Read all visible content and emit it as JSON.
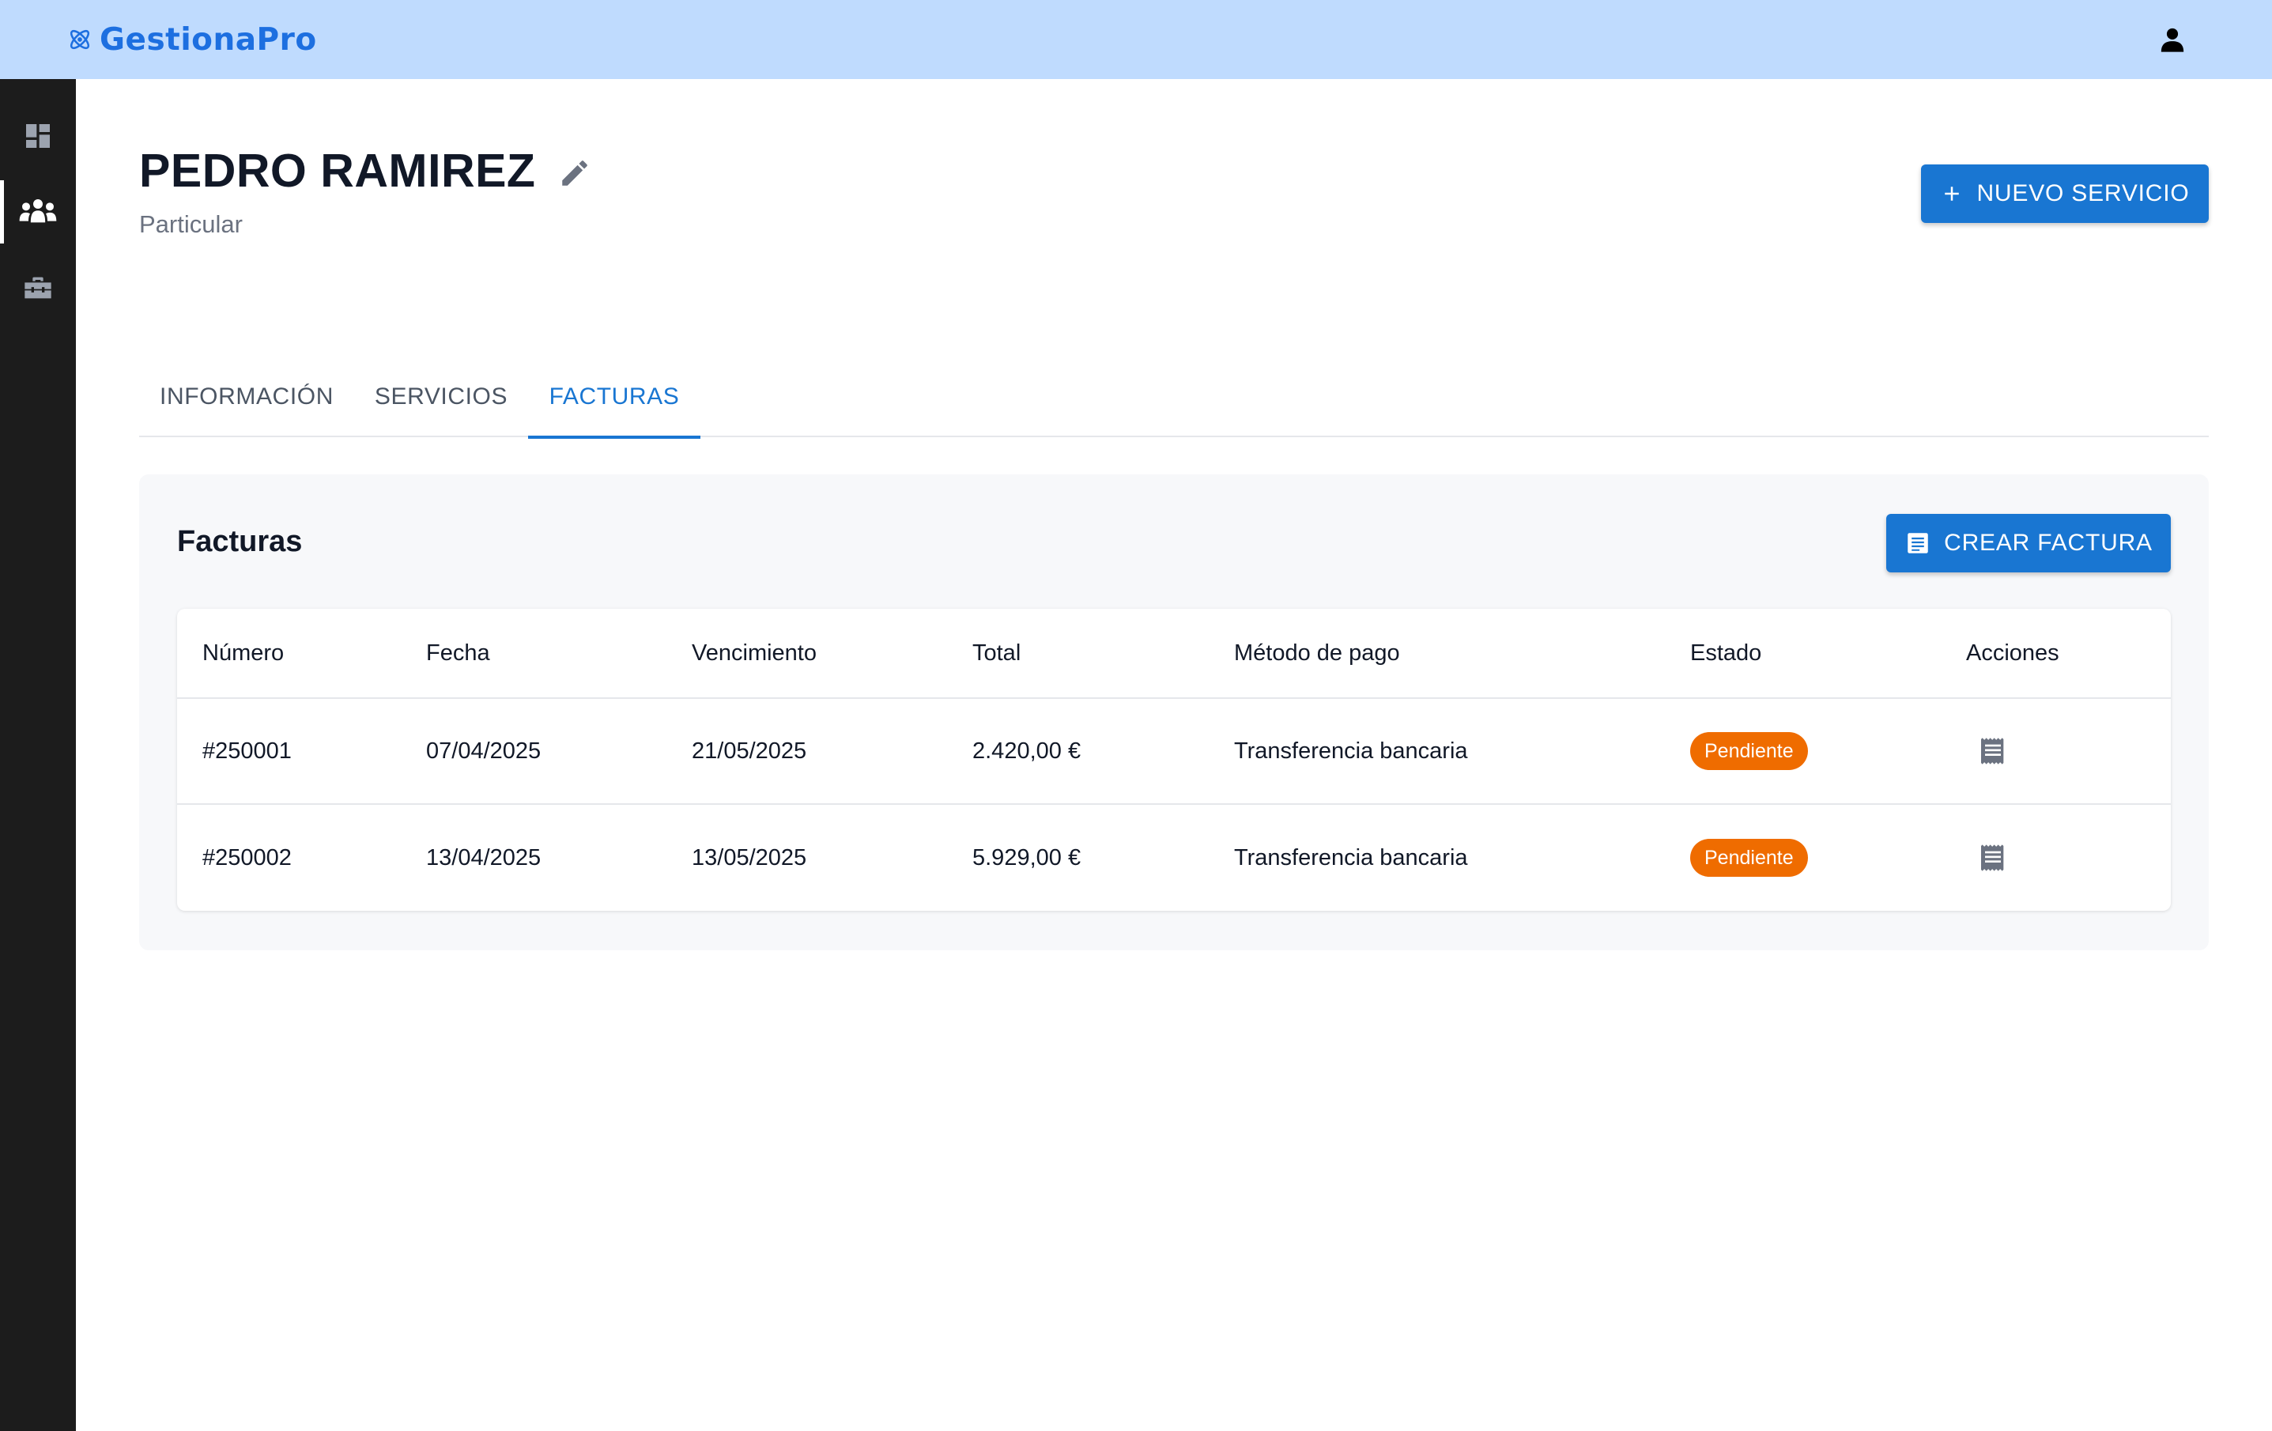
{
  "app": {
    "brand": "GestionaPro",
    "brand_color": "#1d6fe0",
    "topbar_color": "#bfdbfe",
    "icons": {
      "brand": "atom-icon",
      "user": "user-icon"
    }
  },
  "sidebar": {
    "items": [
      {
        "id": "dashboard",
        "icon": "dashboard-icon",
        "active": false
      },
      {
        "id": "clients",
        "icon": "group-icon",
        "active": true
      },
      {
        "id": "services",
        "icon": "toolbox-icon",
        "active": false
      }
    ]
  },
  "client": {
    "name": "PEDRO RAMIREZ",
    "type": "Particular"
  },
  "header": {
    "new_service_label": "NUEVO SERVICIO",
    "accent": "#1976d2"
  },
  "tabs": [
    {
      "label": "INFORMACIÓN",
      "active": false
    },
    {
      "label": "SERVICIOS",
      "active": false
    },
    {
      "label": "FACTURAS",
      "active": true
    }
  ],
  "invoices": {
    "title": "Facturas",
    "create_label": "CREAR FACTURA",
    "columns": [
      "Número",
      "Fecha",
      "Vencimiento",
      "Total",
      "Método de pago",
      "Estado",
      "Acciones"
    ],
    "rows": [
      {
        "number": "#250001",
        "date": "07/04/2025",
        "due": "21/05/2025",
        "total": "2.420,00 €",
        "payment": "Transferencia bancaria",
        "status": "Pendiente"
      },
      {
        "number": "#250002",
        "date": "13/04/2025",
        "due": "13/05/2025",
        "total": "5.929,00 €",
        "payment": "Transferencia bancaria",
        "status": "Pendiente"
      }
    ],
    "status_color": "#ef6c00"
  }
}
